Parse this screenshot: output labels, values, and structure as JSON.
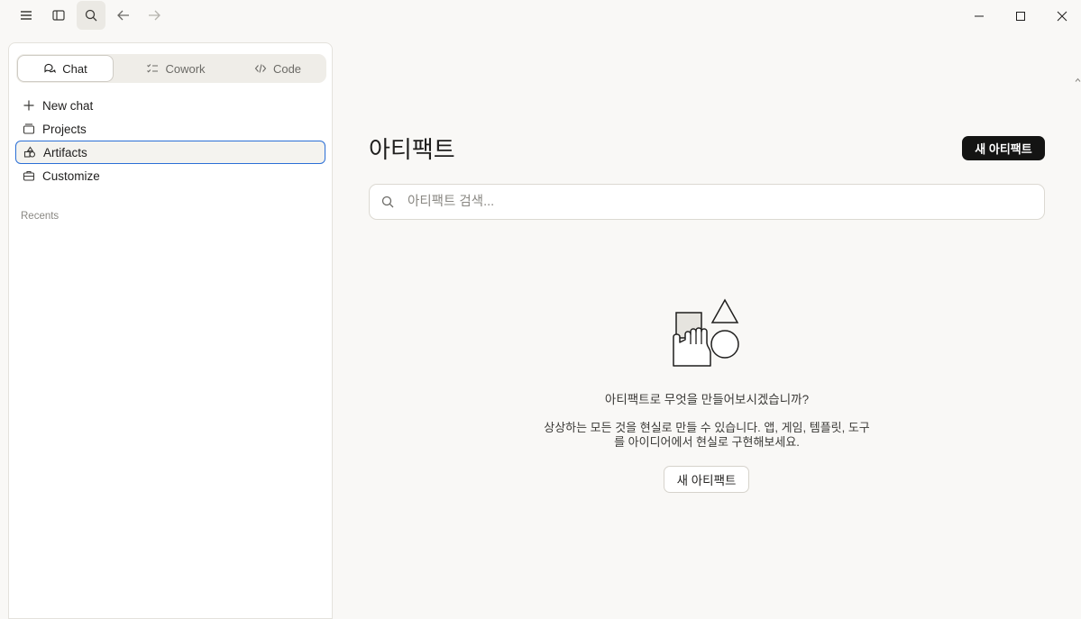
{
  "toolbar": {
    "icons": [
      "menu-icon",
      "sidebar-toggle-icon",
      "search-icon",
      "back-arrow-icon",
      "forward-arrow-icon"
    ],
    "window_controls": [
      "minimize-icon",
      "maximize-icon",
      "close-icon"
    ]
  },
  "sidebar": {
    "modes": [
      {
        "label": "Chat",
        "icon": "chat-bubbles-icon",
        "active": true
      },
      {
        "label": "Cowork",
        "icon": "checklist-icon",
        "active": false
      },
      {
        "label": "Code",
        "icon": "code-icon",
        "active": false
      }
    ],
    "nav": [
      {
        "label": "New chat",
        "icon": "plus-icon"
      },
      {
        "label": "Projects",
        "icon": "folder-icon"
      },
      {
        "label": "Artifacts",
        "icon": "shapes-icon",
        "selected": true
      },
      {
        "label": "Customize",
        "icon": "briefcase-icon"
      }
    ],
    "recents_label": "Recents"
  },
  "main": {
    "title": "아티팩트",
    "new_button": "새 아티팩트",
    "search_placeholder": "아티팩트 검색...",
    "empty": {
      "title": "아티팩트로 무엇을 만들어보시겠습니까?",
      "desc_line1": "상상하는 모든 것을 현실로 만들 수 있습니다. 앱, 게임, 템플릿, 도구",
      "desc_line2": "를 아이디어에서 현실로 구현해보세요.",
      "button": "새 아티팩트"
    }
  },
  "colors": {
    "accent": "#2b6fd6",
    "primary_button": "#141413",
    "background": "#f9f8f6"
  }
}
